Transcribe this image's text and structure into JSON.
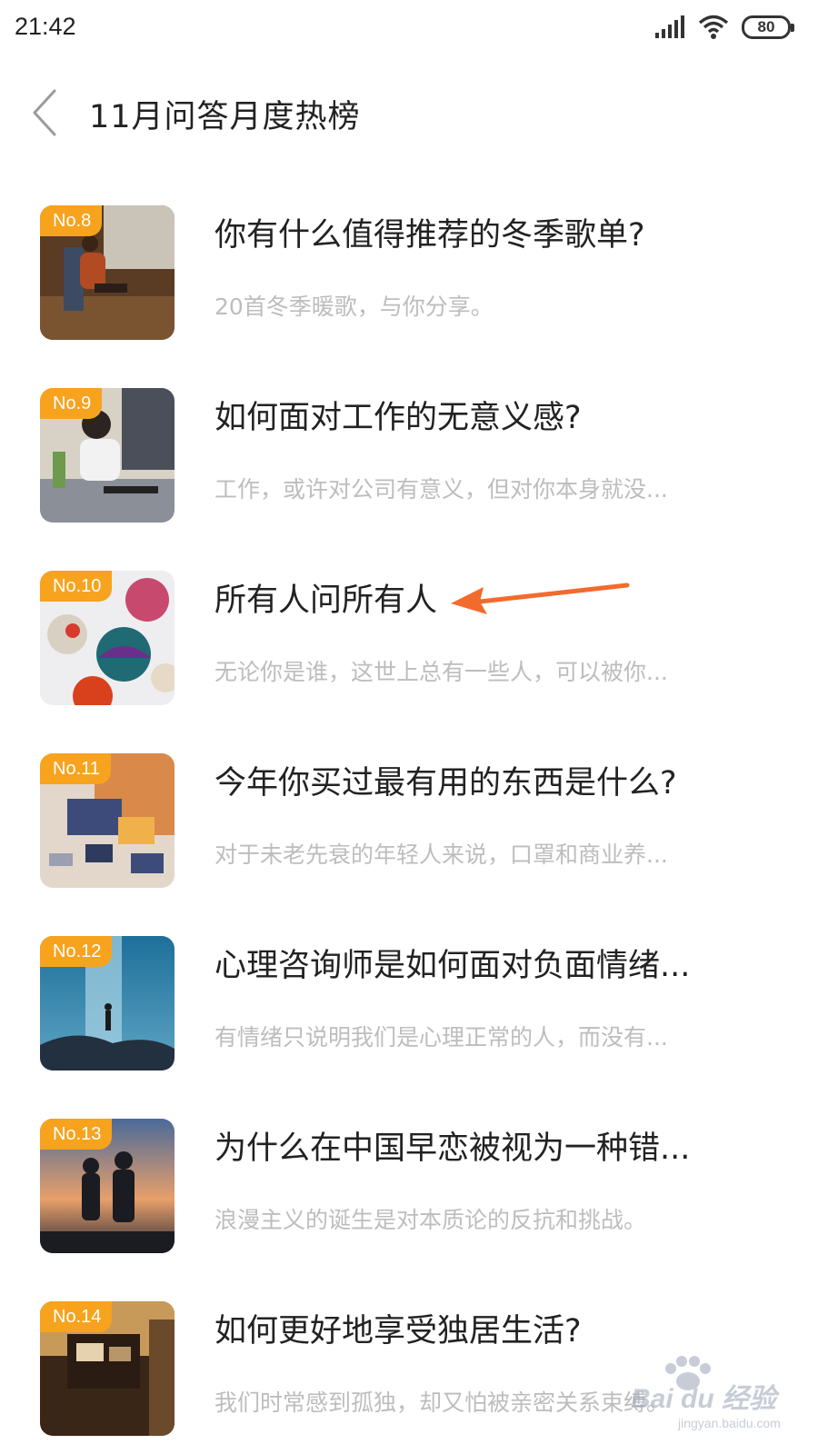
{
  "status_bar": {
    "time": "21:42",
    "battery": "80"
  },
  "header": {
    "title": "11月问答月度热榜"
  },
  "items": [
    {
      "rank": "No.8",
      "title": "你有什么值得推荐的冬季歌单?",
      "subtitle": "20首冬季暖歌，与你分享。"
    },
    {
      "rank": "No.9",
      "title": "如何面对工作的无意义感?",
      "subtitle": "工作，或许对公司有意义，但对你本身就没..."
    },
    {
      "rank": "No.10",
      "title": "所有人问所有人",
      "subtitle": "无论你是谁，这世上总有一些人，可以被你..."
    },
    {
      "rank": "No.11",
      "title": "今年你买过最有用的东西是什么?",
      "subtitle": "对于未老先衰的年轻人来说，口罩和商业养..."
    },
    {
      "rank": "No.12",
      "title": "心理咨询师是如何面对负面情绪...",
      "subtitle": "有情绪只说明我们是心理正常的人，而没有..."
    },
    {
      "rank": "No.13",
      "title": "为什么在中国早恋被视为一种错...",
      "subtitle": "浪漫主义的诞生是对本质论的反抗和挑战。"
    },
    {
      "rank": "No.14",
      "title": "如何更好地享受独居生活?",
      "subtitle": "我们时常感到孤独，却又怕被亲密关系束缚。"
    }
  ],
  "watermark": {
    "text": "Bai du 经验",
    "url": "jingyan.baidu.com"
  },
  "colors": {
    "badge": "#f7a31e",
    "arrow": "#f26b2d"
  }
}
